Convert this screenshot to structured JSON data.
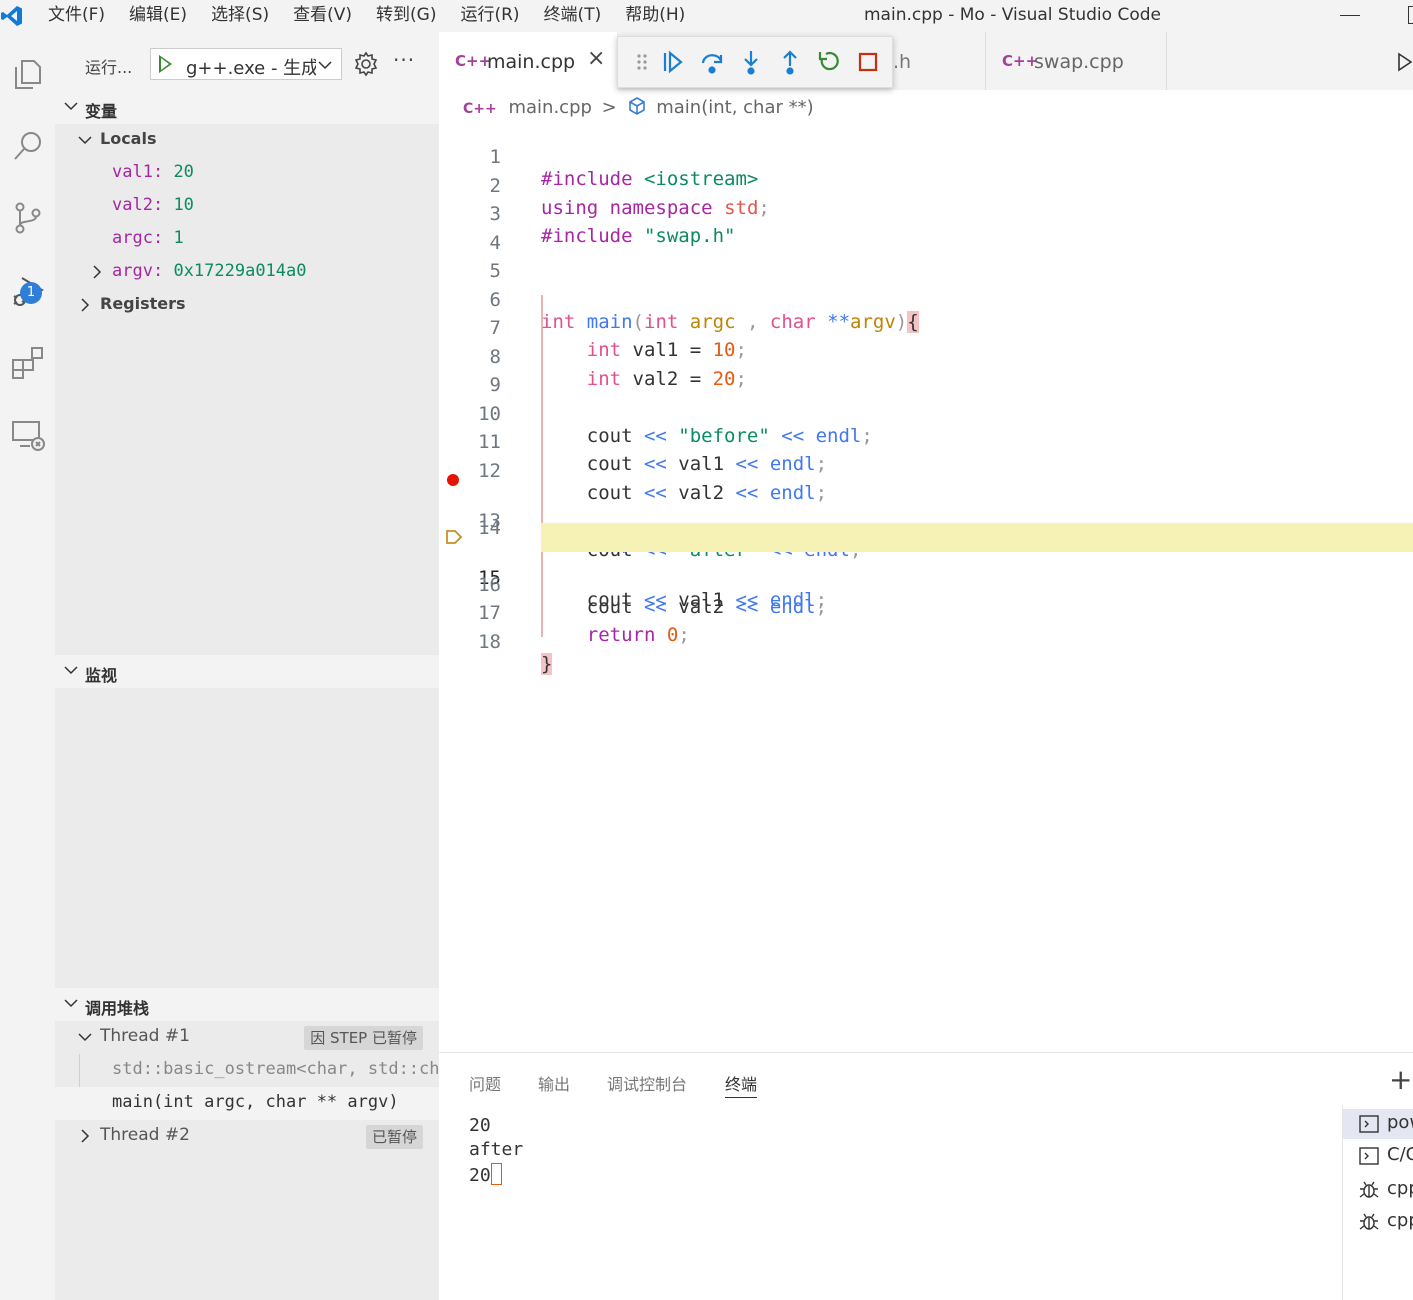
{
  "menu": [
    "文件(F)",
    "编辑(E)",
    "选择(S)",
    "查看(V)",
    "转到(G)",
    "运行(R)",
    "终端(T)",
    "帮助(H)"
  ],
  "window_title": "main.cpp - Mo - Visual Studio Code",
  "activity": {
    "debug_badge": "1"
  },
  "sidebar": {
    "run_label": "运行...",
    "config": "g++.exe - 生成",
    "variables": {
      "header": "变量",
      "locals_label": "Locals",
      "items": [
        {
          "name": "val1",
          "value": "20"
        },
        {
          "name": "val2",
          "value": "10"
        },
        {
          "name": "argc",
          "value": "1"
        },
        {
          "name": "argv",
          "value": "0x17229a014a0"
        }
      ],
      "registers_label": "Registers"
    },
    "watch": {
      "header": "监视"
    },
    "callstack": {
      "header": "调用堆栈",
      "thread1": "Thread #1",
      "thread1_badge": "因 STEP 已暂停",
      "frames": [
        "std::basic_ostream<char, std::char_traits<char> >",
        "main(int argc, char ** argv)"
      ],
      "thread2": "Thread #2",
      "thread2_badge": "已暂停"
    }
  },
  "editor": {
    "tabs": [
      {
        "icon": "C++",
        "label": "main.cpp",
        "close": "×"
      },
      {
        "label": ".h"
      },
      {
        "icon": "C++",
        "label": "swap.cpp"
      }
    ],
    "breadcrumb": {
      "file": "main.cpp",
      "sep": ">",
      "symbol": "main(int, char **)"
    },
    "line_numbers": [
      "1",
      "2",
      "3",
      "4",
      "5",
      "6",
      "7",
      "8",
      "9",
      "10",
      "11",
      "12",
      "13",
      "14",
      "15",
      "16",
      "17",
      "18"
    ],
    "breakpoint_line": 13,
    "current_line": 15
  },
  "panel": {
    "tabs": [
      "问题",
      "输出",
      "调试控制台",
      "终端"
    ],
    "active_tab": "终端",
    "plus": "+",
    "terminal_lines": [
      "20",
      "after",
      "20"
    ],
    "terminals": [
      "pow",
      "C/C",
      "cpp",
      "cpp"
    ]
  }
}
